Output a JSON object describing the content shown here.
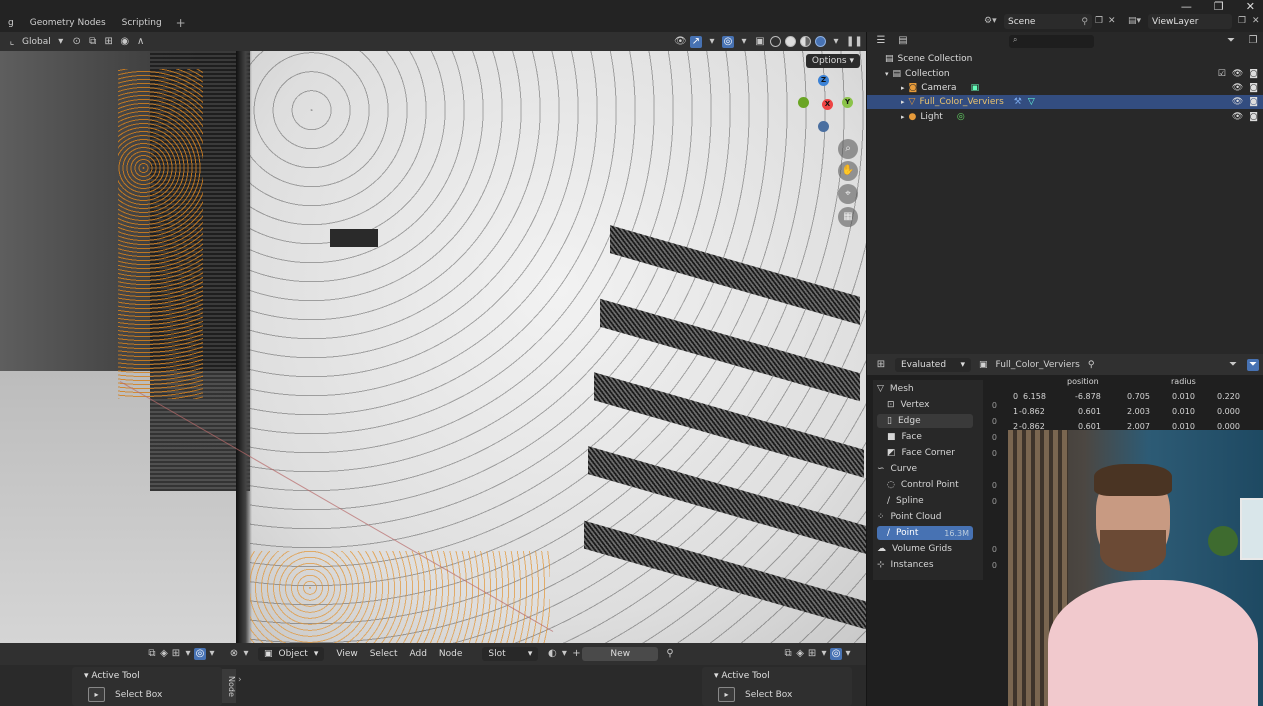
{
  "workspace_tabs": [
    "g",
    "Geometry Nodes",
    "Scripting"
  ],
  "window_controls": [
    "—",
    "❐",
    "✕"
  ],
  "scene": {
    "label": "Scene",
    "view_layer": "ViewLayer"
  },
  "viewport": {
    "transform_orientation": "Global",
    "options_label": "Options",
    "gizmo_axes": {
      "z": "Z",
      "x": "X",
      "y": "Y"
    }
  },
  "viewport_footer": {
    "mode": "Object",
    "menus": [
      "View",
      "Select",
      "Add",
      "Node"
    ],
    "slot": "Slot",
    "new_label": "New"
  },
  "tool_panels": {
    "left": {
      "title": "Active Tool",
      "item": "Select Box"
    },
    "right": {
      "title": "Active Tool",
      "item": "Select Box"
    },
    "node_tab": "Node"
  },
  "outliner": {
    "items": [
      {
        "label": "Scene Collection"
      },
      {
        "label": "Collection"
      },
      {
        "label": "Camera"
      },
      {
        "label": "Full_Color_Verviers"
      },
      {
        "label": "Light"
      }
    ]
  },
  "spreadsheet": {
    "evaluated": "Evaluated",
    "object": "Full_Color_Verviers",
    "domains": [
      {
        "label": "Mesh",
        "count": ""
      },
      {
        "label": "Vertex",
        "count": "0"
      },
      {
        "label": "Edge",
        "count": "0"
      },
      {
        "label": "Face",
        "count": "0"
      },
      {
        "label": "Face Corner",
        "count": "0"
      },
      {
        "label": "Curve",
        "count": ""
      },
      {
        "label": "Control Point",
        "count": "0"
      },
      {
        "label": "Spline",
        "count": "0"
      },
      {
        "label": "Point Cloud",
        "count": ""
      },
      {
        "label": "Point",
        "count": "16.3M"
      },
      {
        "label": "Volume Grids",
        "count": "0"
      },
      {
        "label": "Instances",
        "count": "0"
      }
    ],
    "columns": [
      "position",
      "radius"
    ],
    "rows": [
      [
        "0",
        "6.158",
        "-6.878",
        "0.705",
        "0.010",
        "0.220"
      ],
      [
        "1",
        "-0.862",
        "0.601",
        "2.003",
        "0.010",
        "0.000"
      ],
      [
        "2",
        "-0.862",
        "0.601",
        "2.007",
        "0.010",
        "0.000"
      ]
    ]
  },
  "colors": {
    "accent": "#4772b3",
    "orange": "#e79b3a",
    "selected_row": "#334d80"
  }
}
